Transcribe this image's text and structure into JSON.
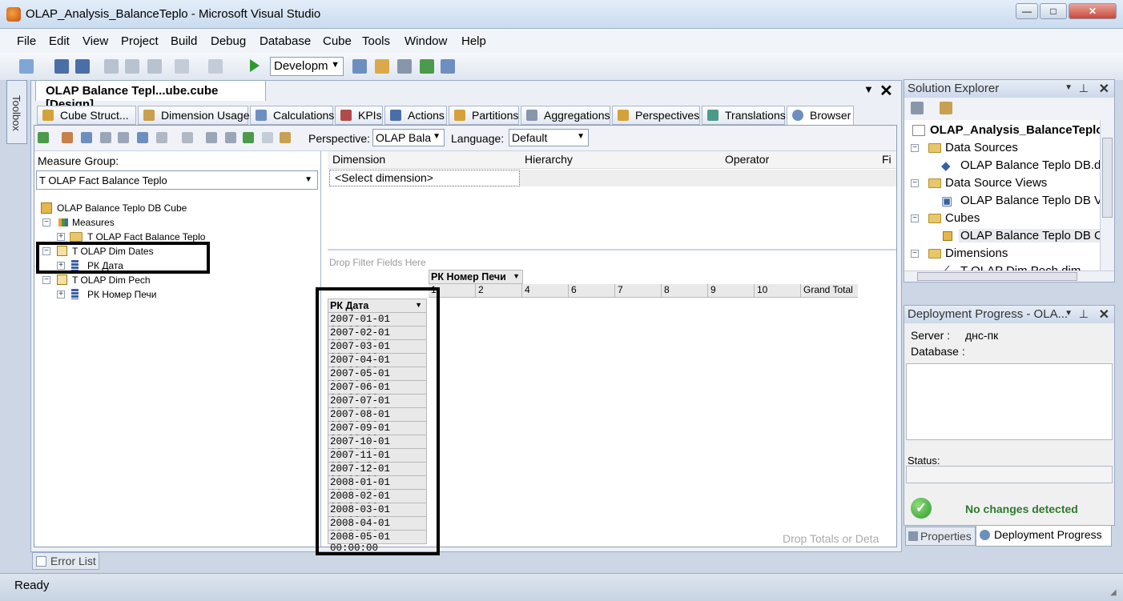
{
  "window": {
    "title": "OLAP_Analysis_BalanceTeplo - Microsoft Visual Studio"
  },
  "menu": [
    "File",
    "Edit",
    "View",
    "Project",
    "Build",
    "Debug",
    "Database",
    "Cube",
    "Tools",
    "Window",
    "Help"
  ],
  "toolbar": {
    "config_value": "Developm"
  },
  "toolbox": {
    "label": "Toolbox"
  },
  "document": {
    "tab_title": "OLAP Balance Tepl...ube.cube [Design]"
  },
  "designer_tabs": [
    "Cube Struct...",
    "Dimension Usage",
    "Calculations",
    "KPIs",
    "Actions",
    "Partitions",
    "Aggregations",
    "Perspectives",
    "Translations",
    "Browser"
  ],
  "browser": {
    "perspective_label": "Perspective:",
    "perspective_value": "OLAP Bala",
    "language_label": "Language:",
    "language_value": "Default",
    "measure_group_label": "Measure Group:",
    "measure_group_value": "T OLAP Fact Balance Teplo",
    "tree": {
      "cube": "OLAP Balance Teplo DB Cube",
      "measures": "Measures",
      "fact": "T OLAP Fact Balance Teplo",
      "dim_dates": "T OLAP Dim Dates",
      "rk_data": "РК Дата",
      "dim_pech": "T OLAP Dim Pech",
      "rk_nomer": "РК Номер Печи"
    },
    "filter_grid": {
      "columns": [
        "Dimension",
        "Hierarchy",
        "Operator",
        "Fi"
      ],
      "select_dimension": "<Select dimension>"
    },
    "drop_filter": "Drop Filter Fields Here",
    "column_field": "РК Номер Печи",
    "column_values": [
      "1",
      "2",
      "4",
      "6",
      "7",
      "8",
      "9",
      "10",
      "Grand Total"
    ],
    "row_field": "РК Дата",
    "row_values": [
      "2007-01-01 00:00:00",
      "2007-02-01 00:00:00",
      "2007-03-01 00:00:00",
      "2007-04-01 00:00:00",
      "2007-05-01 00:00:00",
      "2007-06-01 00:00:00",
      "2007-07-01 00:00:00",
      "2007-08-01 00:00:00",
      "2007-09-01 00:00:00",
      "2007-10-01 00:00:00",
      "2007-11-01 00:00:00",
      "2007-12-01 00:00:00",
      "2008-01-01 00:00:00",
      "2008-02-01 00:00:00",
      "2008-03-01 00:00:00",
      "2008-04-01 00:00:00",
      "2008-05-01 00:00:00"
    ],
    "drop_totals": "Drop Totals or Deta"
  },
  "solution_explorer": {
    "title": "Solution Explorer",
    "project": "OLAP_Analysis_BalanceTeplo",
    "data_sources": "Data Sources",
    "ds_item": "OLAP Balance Teplo DB.ds",
    "dsv": "Data Source Views",
    "dsv_item": "OLAP Balance Teplo DB Vi",
    "cubes": "Cubes",
    "cube_item": "OLAP Balance Teplo DB Cu",
    "dimensions": "Dimensions",
    "dim_item": "T OLAP Dim Pech.dim"
  },
  "deployment": {
    "title": "Deployment Progress - OLA...",
    "server_label": "Server :",
    "server_value": "днс-пк",
    "database_label": "Database :",
    "status_label": "Status:",
    "message": "No changes detected"
  },
  "bottom_tabs": {
    "properties": "Properties",
    "deployment": "Deployment Progress",
    "error_list": "Error List"
  },
  "status": {
    "text": "Ready"
  }
}
